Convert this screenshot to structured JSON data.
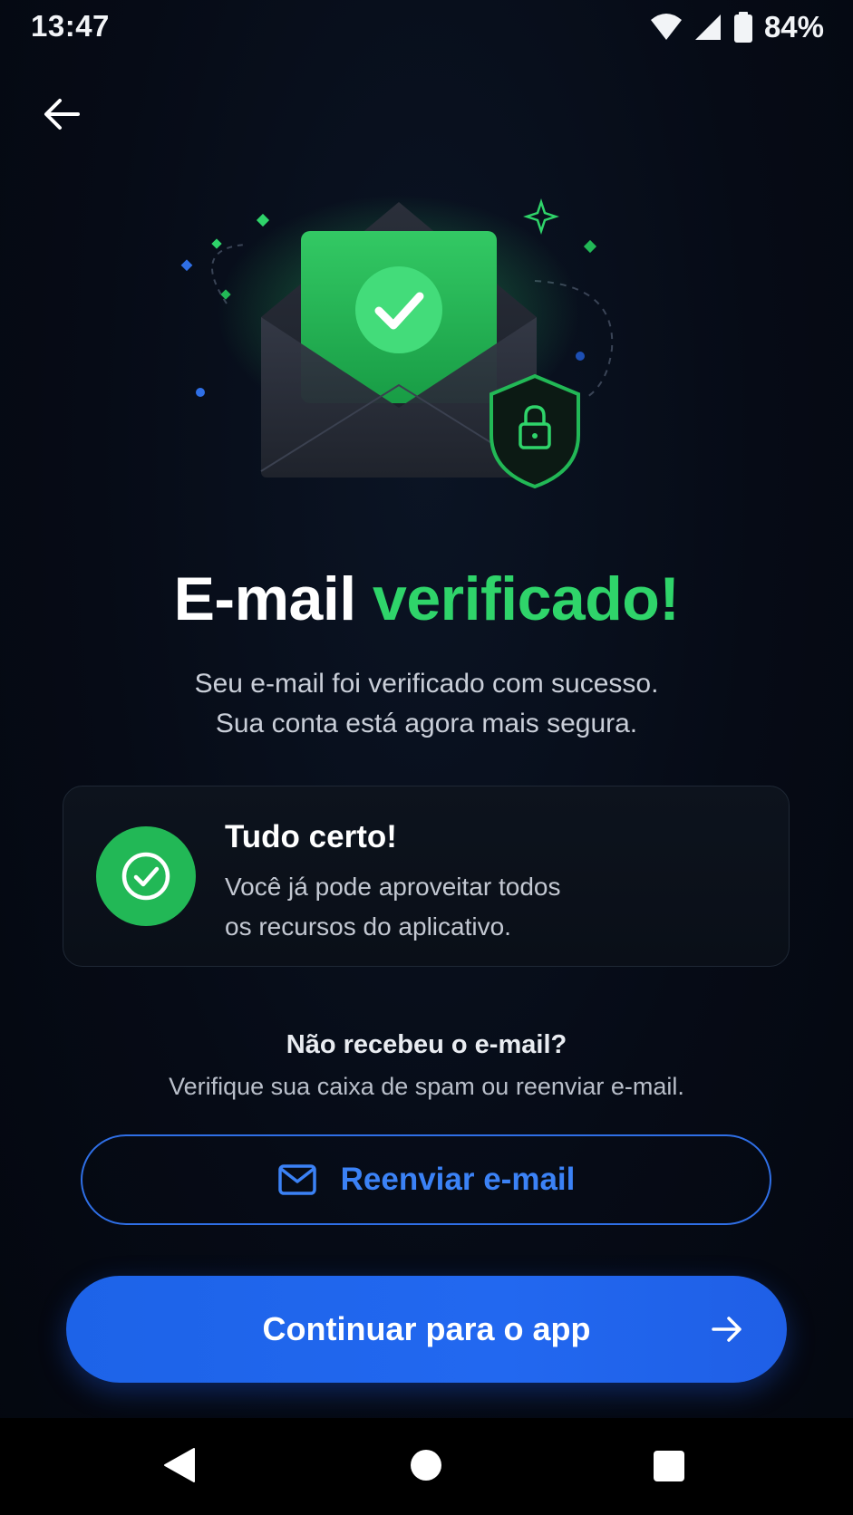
{
  "status_bar": {
    "time": "13:47",
    "battery": "84%",
    "icons": [
      "wifi-icon",
      "signal-icon",
      "battery-icon"
    ]
  },
  "header": {
    "back_icon": "arrow-left-icon"
  },
  "hero": {
    "icons": [
      "envelope-icon",
      "check-icon",
      "shield-lock-icon",
      "sparkle-icon"
    ]
  },
  "title": {
    "part1": "E-mail",
    "part2": "verificado!"
  },
  "subtitle": {
    "line1": "Seu e-mail foi verificado com sucesso.",
    "line2": "Sua conta está agora mais segura."
  },
  "card": {
    "title": "Tudo certo!",
    "line1": "Você já pode aproveitar todos",
    "line2": "os recursos do aplicativo.",
    "icon": "check-circle-icon"
  },
  "resend": {
    "heading": "Não recebeu o e-mail?",
    "hint": "Verifique sua caixa de spam ou reenviar e-mail.",
    "button_label": "Reenviar e-mail",
    "button_icon": "mail-icon"
  },
  "continue": {
    "label": "Continuar para o app",
    "icon": "arrow-right-icon"
  },
  "nav_bar": {
    "items": [
      "nav-back-icon",
      "nav-home-icon",
      "nav-recents-icon"
    ]
  },
  "colors": {
    "background": "#050a14",
    "accent_green": "#2fd46a",
    "accent_blue": "#2268f0",
    "card_border": "#1f2835"
  }
}
